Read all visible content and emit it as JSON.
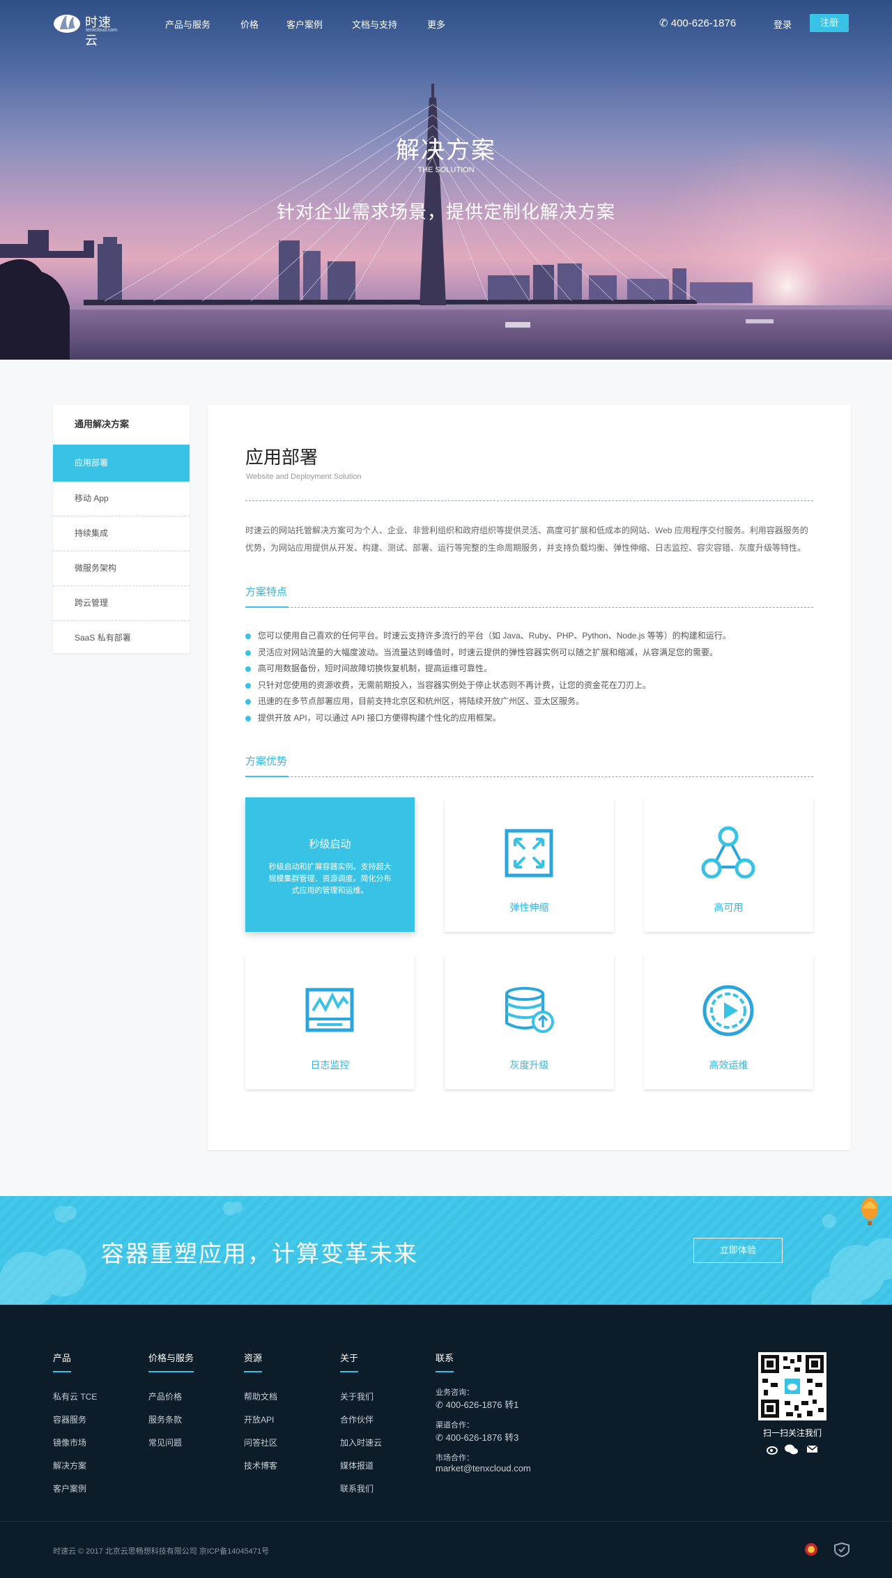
{
  "nav": {
    "logo_text": "时速云",
    "logo_sub": "tenxcloud.com",
    "items": [
      "产品与服务",
      "价格",
      "客户案例",
      "文档与支持",
      "更多"
    ],
    "phone": "400-626-1876",
    "login": "登录",
    "signup": "注册"
  },
  "hero": {
    "title": "解决方案",
    "subtitle_en": "THE SOLUTION",
    "slogan": "针对企业需求场景，提供定制化解决方案"
  },
  "sidebar": {
    "heading": "通用解决方案",
    "items": [
      "应用部署",
      "移动 App",
      "持续集成",
      "微服务架构",
      "跨云管理",
      "SaaS 私有部署"
    ],
    "active_index": 0
  },
  "main": {
    "title": "应用部署",
    "subtitle_en": "Website and Deployment Solution",
    "intro": "时速云的网站托管解决方案可为个人、企业、非营利组织和政府组织等提供灵活、高度可扩展和低成本的网站、Web 应用程序交付服务。利用容器服务的优势，为网站应用提供从开发、构建、测试、部署、运行等完整的生命周期服务，并支持负载均衡、弹性伸缩、日志监控、容灾容错、灰度升级等特性。",
    "features_heading": "方案特点",
    "features": [
      "您可以使用自己喜欢的任何平台。时速云支持许多流行的平台（如 Java、Ruby、PHP、Python、Node.js 等等）的构建和运行。",
      "灵活应对网站流量的大幅度波动。当流量达到峰值时，时速云提供的弹性容器实例可以随之扩展和缩减，从容满足您的需要。",
      "高可用数据备份，短时间故障切换恢复机制，提高运维可靠性。",
      "只针对您使用的资源收费，无需前期投入，当容器实例处于停止状态则不再计费，让您的资金花在刀刃上。",
      "迅速的在多节点部署应用，目前支持北京区和杭州区，将陆续开放广州区、亚太区服务。",
      "提供开放 API，可以通过 API 接口方便得构建个性化的应用框架。"
    ],
    "advantages_heading": "方案优势",
    "advantages": [
      {
        "title": "秒级启动",
        "desc": "秒级启动和扩展容器实例。支持超大规模集群管理、资源调度。简化分布式应用的管理和运维。",
        "icon": "rocket-icon"
      },
      {
        "title": "弹性伸缩",
        "icon": "expand-arrows-icon"
      },
      {
        "title": "高可用",
        "icon": "triangle-nodes-icon"
      },
      {
        "title": "日志监控",
        "icon": "monitor-chart-icon"
      },
      {
        "title": "灰度升级",
        "icon": "database-upgrade-icon"
      },
      {
        "title": "高效运维",
        "icon": "play-circle-icon"
      }
    ]
  },
  "cta": {
    "text": "容器重塑应用，计算变革未来",
    "button": "立即体验"
  },
  "footer": {
    "columns": [
      {
        "heading": "产品",
        "links": [
          "私有云 TCE",
          "容器服务",
          "镜像市场",
          "解决方案",
          "客户案例"
        ]
      },
      {
        "heading": "价格与服务",
        "links": [
          "产品价格",
          "服务条款",
          "常见问题"
        ]
      },
      {
        "heading": "资源",
        "links": [
          "帮助文档",
          "开放API",
          "问答社区",
          "技术博客"
        ]
      },
      {
        "heading": "关于",
        "links": [
          "关于我们",
          "合作伙伴",
          "加入时速云",
          "媒体报道",
          "联系我们"
        ]
      }
    ],
    "contact": {
      "heading": "联系",
      "business_label": "业务咨询：",
      "business_phone": "400-626-1876 转1",
      "channel_label": "渠道合作：",
      "channel_phone": "400-626-1876 转3",
      "market_label": "市场合作：",
      "market_email": "market@tenxcloud.com"
    },
    "qr_caption": "扫一扫关注我们",
    "copyright": "时速云 © 2017 北京云思畅想科技有限公司  京ICP备14045471号"
  },
  "colors": {
    "accent": "#37c2e6",
    "footer_bg": "#0c1c28"
  }
}
